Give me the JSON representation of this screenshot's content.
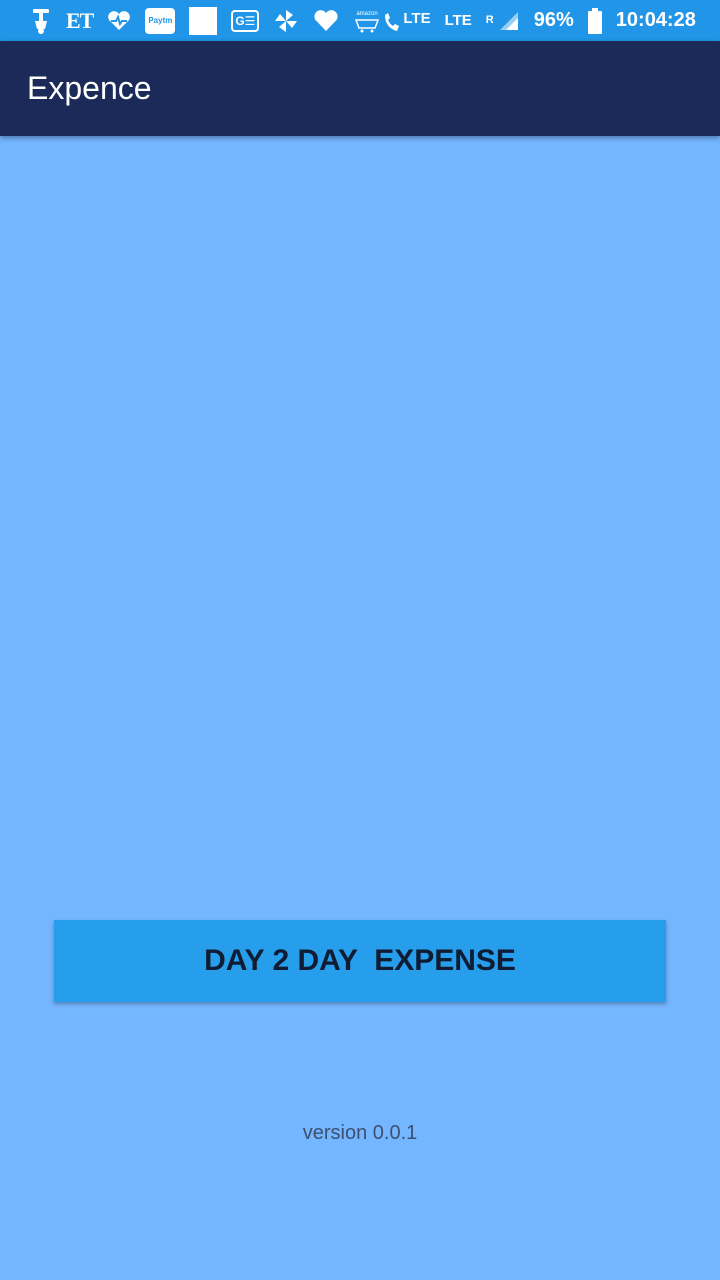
{
  "status_bar": {
    "left_icons": [
      {
        "name": "scooter-icon"
      },
      {
        "name": "et-logo-icon",
        "text": "ET"
      },
      {
        "name": "heart-pulse-icon"
      },
      {
        "name": "paytm-icon",
        "text": "Paytm"
      },
      {
        "name": "blank-square-icon"
      },
      {
        "name": "ge-icon",
        "text": "G☰"
      },
      {
        "name": "pinwheel-icon"
      },
      {
        "name": "heart-icon"
      },
      {
        "name": "amazon-cart-icon",
        "text": "amazon"
      }
    ],
    "lte1": "LTE",
    "lte2": "LTE",
    "roaming": "R",
    "battery_percent": "96%",
    "time": "10:04:28"
  },
  "app_bar": {
    "title": "Expence"
  },
  "main": {
    "button_label": "DAY 2 DAY  EXPENSE",
    "version": "version 0.0.1"
  },
  "colors": {
    "status_bar": "#2196e8",
    "app_bar": "#1b2a58",
    "background": "#74b6ff",
    "button": "#279eeb"
  }
}
